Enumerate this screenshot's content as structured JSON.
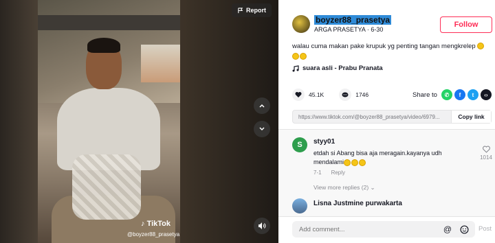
{
  "video": {
    "report_label": "Report",
    "tiktok_logo": "TikTok",
    "watermark_user": "@boyzer88_prasetya"
  },
  "author": {
    "username": "boyzer88_prasetya",
    "display_name": "ARGA PRASETYA",
    "date": "6-30",
    "follow_label": "Follow"
  },
  "caption": "walau cuma makan pake krupuk yg penting tangan mengkrelep",
  "music": "suara asli - Prabu Pranata",
  "stats": {
    "likes": "45.1K",
    "comments": "1746"
  },
  "share": {
    "label": "Share to",
    "colors": {
      "whatsapp": "#25d366",
      "facebook": "#1877f2",
      "twitter": "#1da1f2",
      "embed": "#161823"
    }
  },
  "link": {
    "url": "https://www.tiktok.com/@boyzer88_prasetya/video/6979...",
    "copy_label": "Copy link"
  },
  "comments": [
    {
      "avatar_letter": "S",
      "username": "styy01",
      "text": "etdah si Abang bisa aja meragain.kayanya udh mendalami",
      "date": "7-1",
      "reply_label": "Reply",
      "likes": "1014",
      "more_replies": "View more replies (2)"
    },
    {
      "username": "Lisna Justmine purwakarta"
    }
  ],
  "compose": {
    "placeholder": "Add comment...",
    "post_label": "Post"
  }
}
